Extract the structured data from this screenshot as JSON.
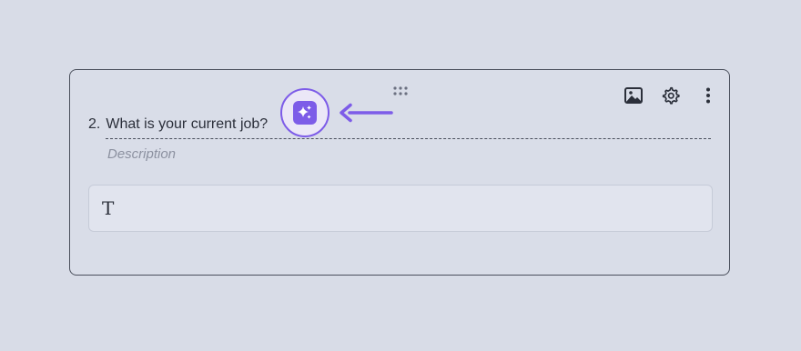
{
  "question": {
    "number": "2.",
    "title": "What is your current job?",
    "description_placeholder": "Description",
    "answer_type_glyph": "T"
  },
  "toolbar": {
    "icons": [
      "image-icon",
      "gear-icon",
      "more-vertical-icon"
    ]
  },
  "ai_button": {
    "icon": "sparkles-icon"
  },
  "colors": {
    "background": "#d8dce7",
    "accent": "#7d5ce8",
    "text": "#2b2f3a",
    "placeholder": "#8c91a0"
  }
}
